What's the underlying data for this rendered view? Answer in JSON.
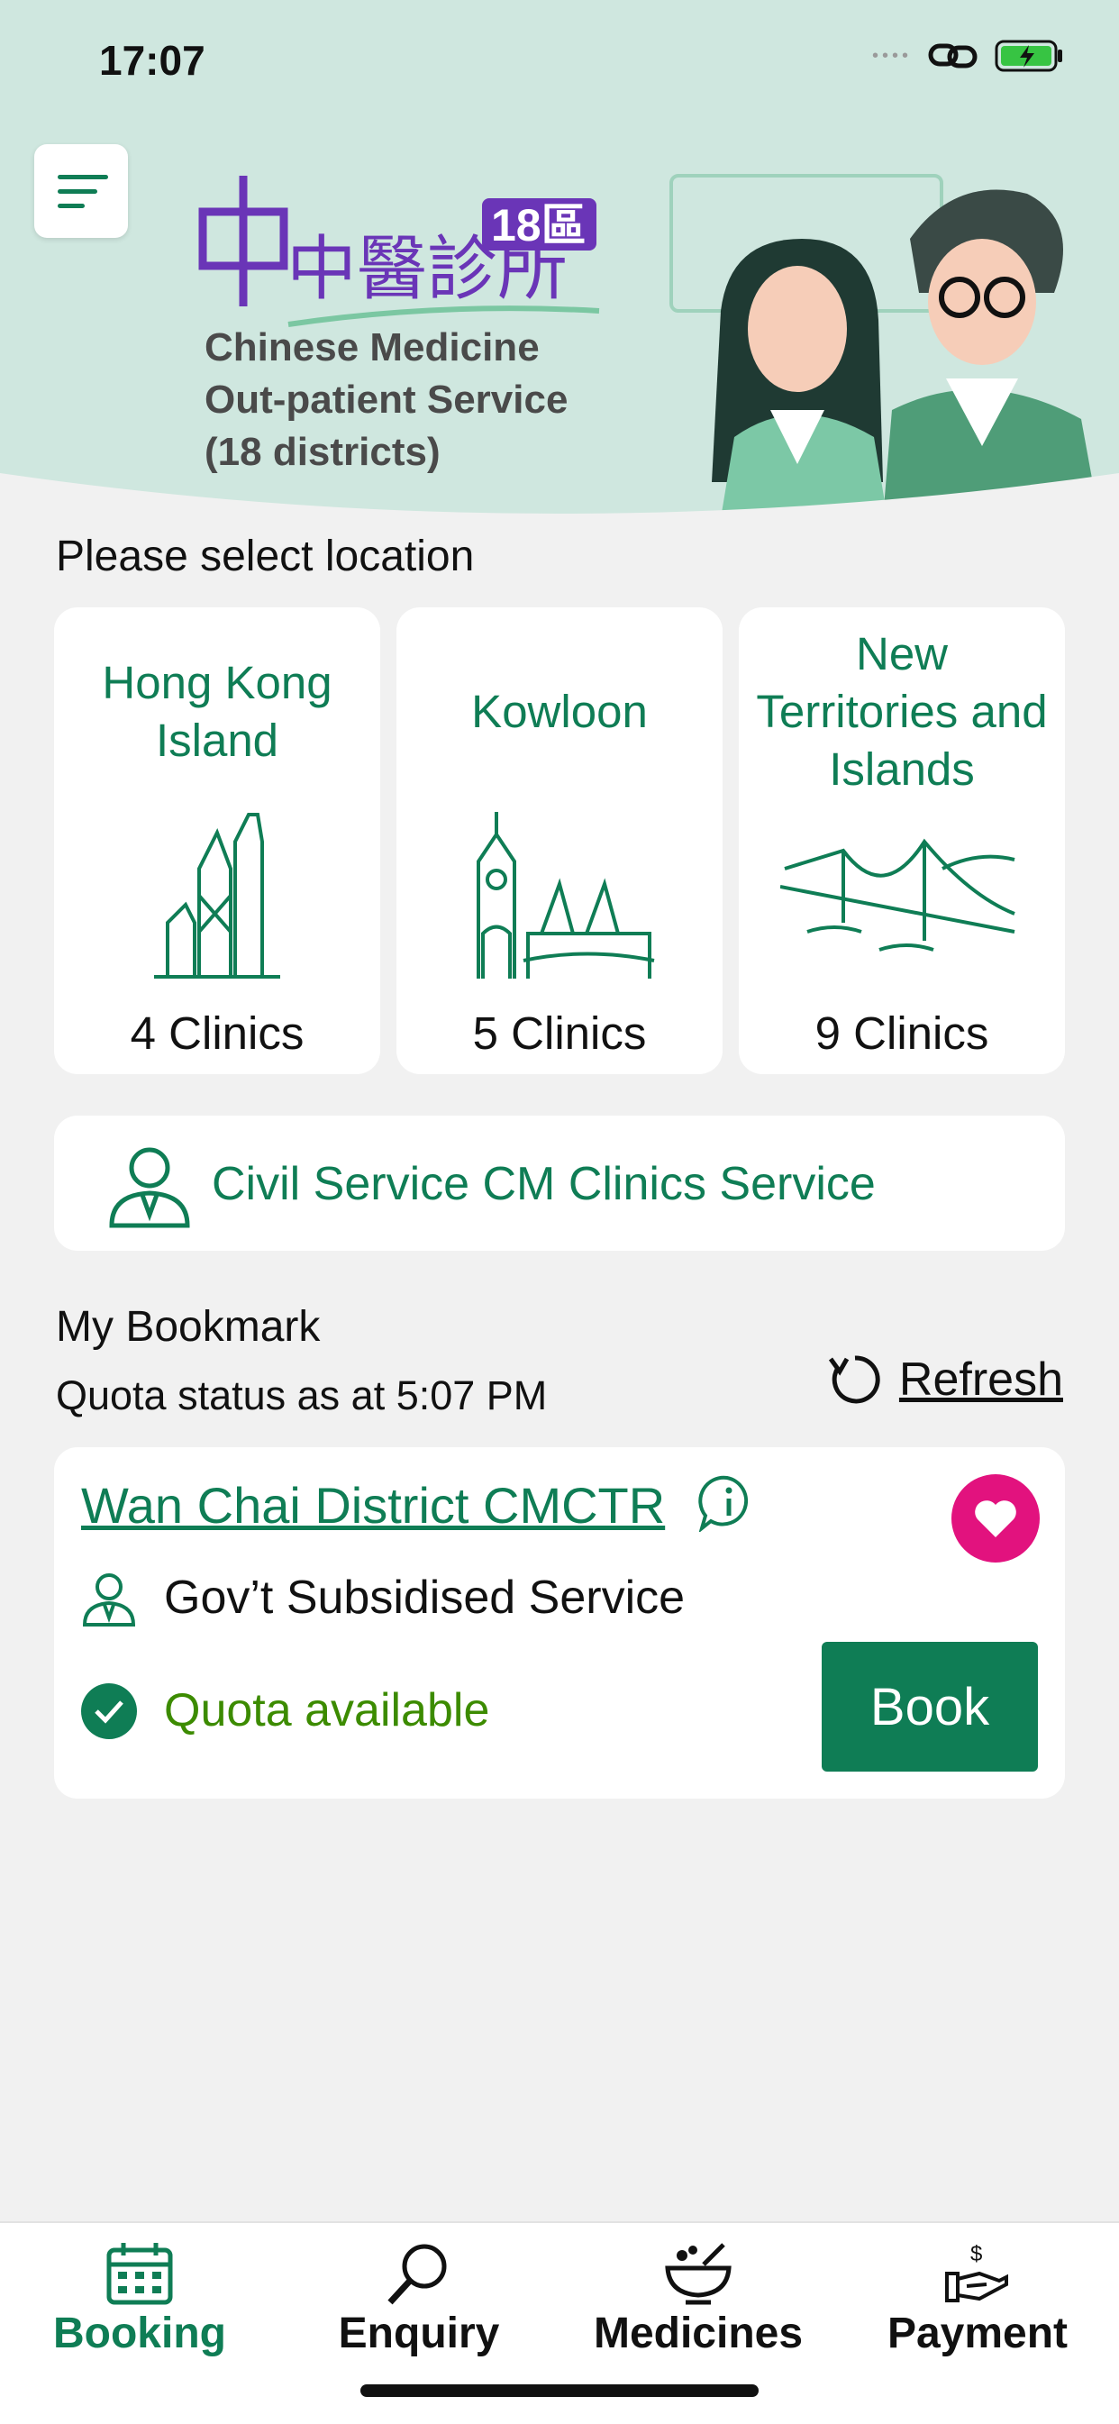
{
  "status_bar": {
    "time": "17:07"
  },
  "header": {
    "logo_cjk": "中醫診所",
    "logo_badge": "18區",
    "logo_line1": "Chinese Medicine",
    "logo_line2": "Out-patient Service",
    "logo_line3": "(18 districts)"
  },
  "location_section": {
    "title": "Please select location",
    "regions": [
      {
        "name_line1": "Hong Kong",
        "name_line2": "Island",
        "name_line3": "",
        "count": "4 Clinics"
      },
      {
        "name_line1": "Kowloon",
        "name_line2": "",
        "name_line3": "",
        "count": "5 Clinics"
      },
      {
        "name_line1": "New",
        "name_line2": "Territories and",
        "name_line3": "Islands",
        "count": "9 Clinics"
      }
    ]
  },
  "civil_service": {
    "label": "Civil Service CM Clinics Service"
  },
  "bookmark": {
    "title": "My Bookmark",
    "quota_time": "Quota status as at 5:07 PM",
    "refresh_label": "Refresh",
    "clinic": {
      "name": "Wan Chai District CMCTR",
      "service": "Gov’t Subsidised Service",
      "quota_status": "Quota available",
      "book_label": "Book"
    }
  },
  "tabbar": {
    "tabs": [
      {
        "label": "Booking",
        "icon": "calendar-icon",
        "active": true
      },
      {
        "label": "Enquiry",
        "icon": "magnifier-icon",
        "active": false
      },
      {
        "label": "Medicines",
        "icon": "herb-bowl-icon",
        "active": false
      },
      {
        "label": "Payment",
        "icon": "payment-hand-icon",
        "active": false
      }
    ]
  },
  "colors": {
    "brand_green": "#0f7d55",
    "header_bg": "#cfe7df",
    "logo_purple": "#6a35b7",
    "heart_pink": "#e2127e",
    "quota_green": "#3c8b00"
  }
}
